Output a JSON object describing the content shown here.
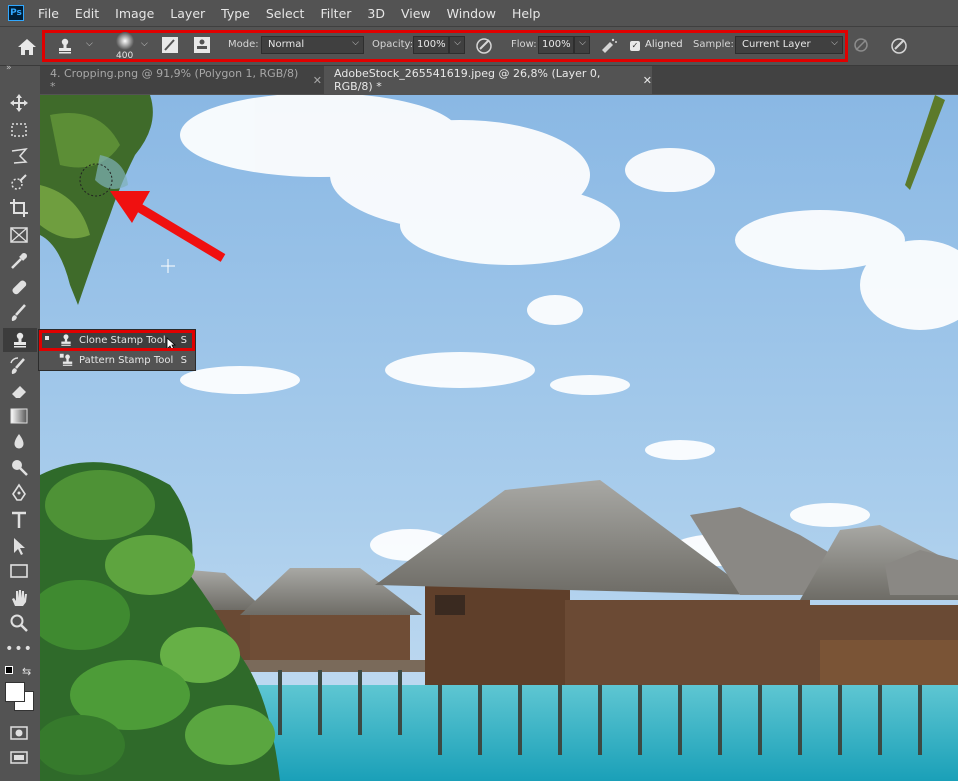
{
  "app": {
    "logo": "Ps"
  },
  "menu": [
    "File",
    "Edit",
    "Image",
    "Layer",
    "Type",
    "Select",
    "Filter",
    "3D",
    "View",
    "Window",
    "Help"
  ],
  "options": {
    "brush_size": "400",
    "mode_label": "Mode:",
    "mode_value": "Normal",
    "opacity_label": "Opacity:",
    "opacity_value": "100%",
    "flow_label": "Flow:",
    "flow_value": "100%",
    "aligned_label": "Aligned",
    "sample_label": "Sample:",
    "sample_value": "Current Layer"
  },
  "tabs": [
    {
      "label": "4. Cropping.png @ 91,9% (Polygon 1, RGB/8) *",
      "close": "✕"
    },
    {
      "label": "AdobeStock_265541619.jpeg @ 26,8% (Layer 0, RGB/8) *",
      "close": "✕"
    }
  ],
  "flyout": {
    "items": [
      {
        "label": "Clone Stamp Tool",
        "key": "S"
      },
      {
        "label": "Pattern Stamp Tool",
        "key": "S"
      }
    ]
  },
  "colors": {
    "highlight": "#e00000",
    "ui_bg": "#535353",
    "tab_bg": "#424242",
    "arrow": "#f01010"
  },
  "icons": [
    "home-icon",
    "clone-stamp-icon",
    "brush-preset-icon",
    "toggle-brush-panel-icon",
    "toggle-clone-source-icon",
    "airbrush-icon",
    "pressure-icon",
    "ignore-adjustment-icon",
    "move-icon",
    "marquee-icon",
    "lasso-icon",
    "quick-select-icon",
    "crop-icon",
    "frame-icon",
    "eyedropper-icon",
    "healing-icon",
    "brush-icon",
    "history-brush-icon",
    "eraser-icon",
    "gradient-icon",
    "blur-icon",
    "dodge-icon",
    "pen-icon",
    "type-icon",
    "path-select-icon",
    "rectangle-icon",
    "hand-icon",
    "zoom-icon",
    "more-tools-icon",
    "swap-colors-icon",
    "quick-mask-icon",
    "screen-mode-icon"
  ]
}
